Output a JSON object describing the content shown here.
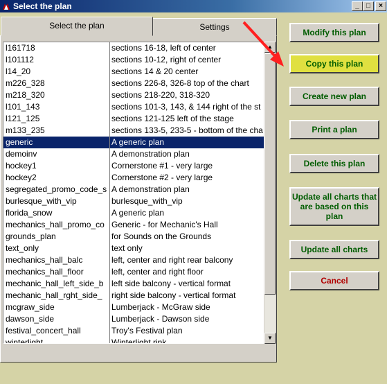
{
  "window": {
    "title": "Select the plan"
  },
  "tabs": [
    {
      "label": "Select the plan",
      "active": true
    },
    {
      "label": "Settings",
      "active": false
    }
  ],
  "plans": [
    {
      "name": "l161718",
      "description": "sections 16-18, left of center"
    },
    {
      "name": "l101112",
      "description": "sections 10-12, right of center"
    },
    {
      "name": "l14_20",
      "description": "sections 14 & 20 center"
    },
    {
      "name": "m226_328",
      "description": "sections 226-8, 326-8 top of the chart"
    },
    {
      "name": "m218_320",
      "description": "sections 218-220, 318-320"
    },
    {
      "name": "l101_143",
      "description": "sections 101-3, 143, & 144 right of the st"
    },
    {
      "name": "l121_125",
      "description": "sections 121-125 left of the stage"
    },
    {
      "name": "m133_235",
      "description": "sections 133-5, 233-5 - bottom of the cha"
    },
    {
      "name": "generic",
      "description": "A generic plan",
      "selected": true
    },
    {
      "name": "demoinv",
      "description": "A demonstration plan"
    },
    {
      "name": "hockey1",
      "description": "Cornerstone #1 - very large"
    },
    {
      "name": "hockey2",
      "description": "Cornerstone #2 - very large"
    },
    {
      "name": "segregated_promo_code_s",
      "description": "A demonstration plan"
    },
    {
      "name": "burlesque_with_vip",
      "description": "burlesque_with_vip"
    },
    {
      "name": "florida_snow",
      "description": "A generic plan"
    },
    {
      "name": "mechanics_hall_promo_co",
      "description": "Generic - for Mechanic's Hall"
    },
    {
      "name": "grounds_plan",
      "description": "for Sounds on the Grounds"
    },
    {
      "name": "text_only",
      "description": "text only"
    },
    {
      "name": "mechanics_hall_balc",
      "description": "left, center and right rear balcony"
    },
    {
      "name": "mechanics_hall_floor",
      "description": "left, center and right floor"
    },
    {
      "name": "mechanic_hall_left_side_b",
      "description": "left side balcony - vertical format"
    },
    {
      "name": "mechanic_hall_rght_side_",
      "description": "right side balcony - vertical format"
    },
    {
      "name": "mcgraw_side",
      "description": "Lumberjack - McGraw side"
    },
    {
      "name": "dawson_side",
      "description": "Lumberjack - Dawson side"
    },
    {
      "name": "festival_concert_hall",
      "description": "Troy's Festival plan"
    },
    {
      "name": "winterlight",
      "description": "Winterlight rink"
    }
  ],
  "buttons": {
    "modify": "Modify this plan",
    "copy": "Copy this plan",
    "create": "Create new plan",
    "print": "Print a plan",
    "delete": "Delete this plan",
    "update_based": "Update all charts that are based on this plan",
    "update_all": "Update all charts",
    "cancel": "Cancel"
  },
  "colors": {
    "highlight_button": "#e0e040",
    "button_text": "#005c00",
    "cancel_text": "#b00000",
    "selection": "#0a246a",
    "annotation_arrow": "#ff2020"
  }
}
